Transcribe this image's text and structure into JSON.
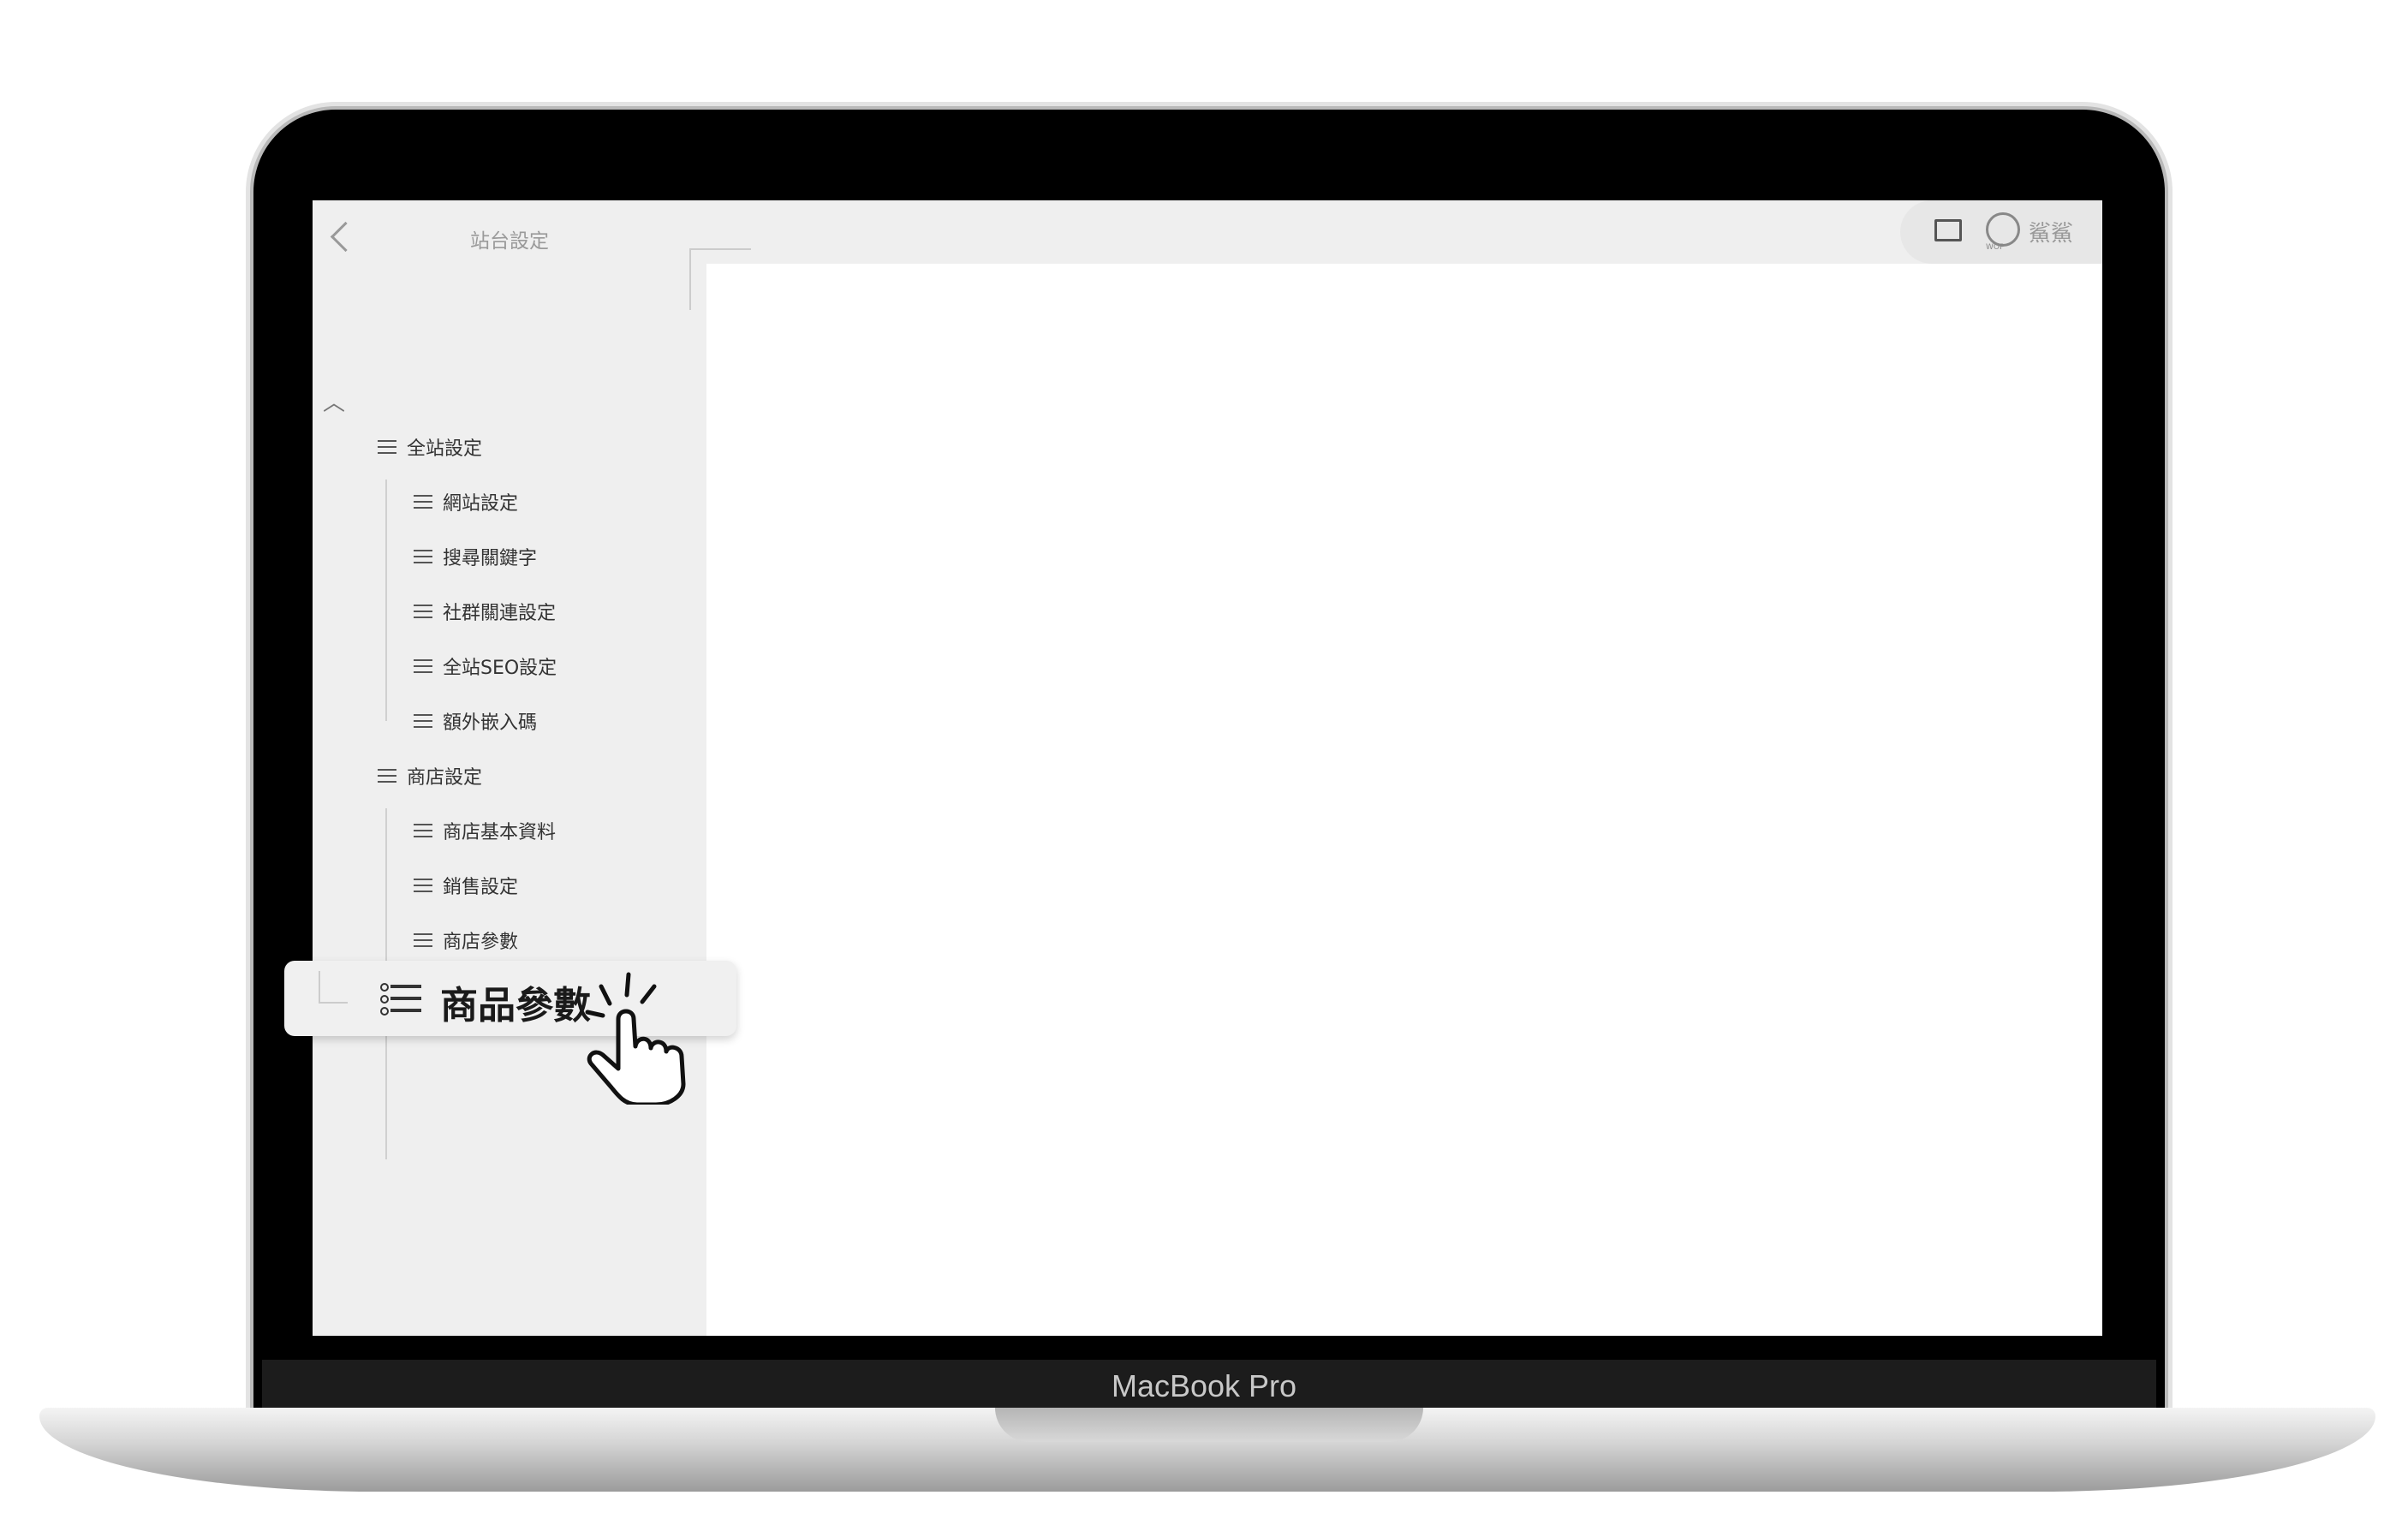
{
  "device": {
    "brand_label": "MacBook Pro"
  },
  "sidebar": {
    "title": "站台設定",
    "groups": [
      {
        "label": "全站設定",
        "items": [
          "網站設定",
          "搜尋關鍵字",
          "社群關連設定",
          "全站SEO設定",
          "額外嵌入碼"
        ]
      },
      {
        "label": "商店設定",
        "items": [
          "商店基本資料",
          "銷售設定",
          "商店參數"
        ]
      }
    ]
  },
  "header": {
    "user_name": "鯊鯊",
    "logo_text": "WOP"
  },
  "callout": {
    "label": "商品參數"
  },
  "icons": [
    "back-icon",
    "collapse-icon",
    "list-icon",
    "chat-icon",
    "logo-icon",
    "pointer-hand-icon"
  ]
}
